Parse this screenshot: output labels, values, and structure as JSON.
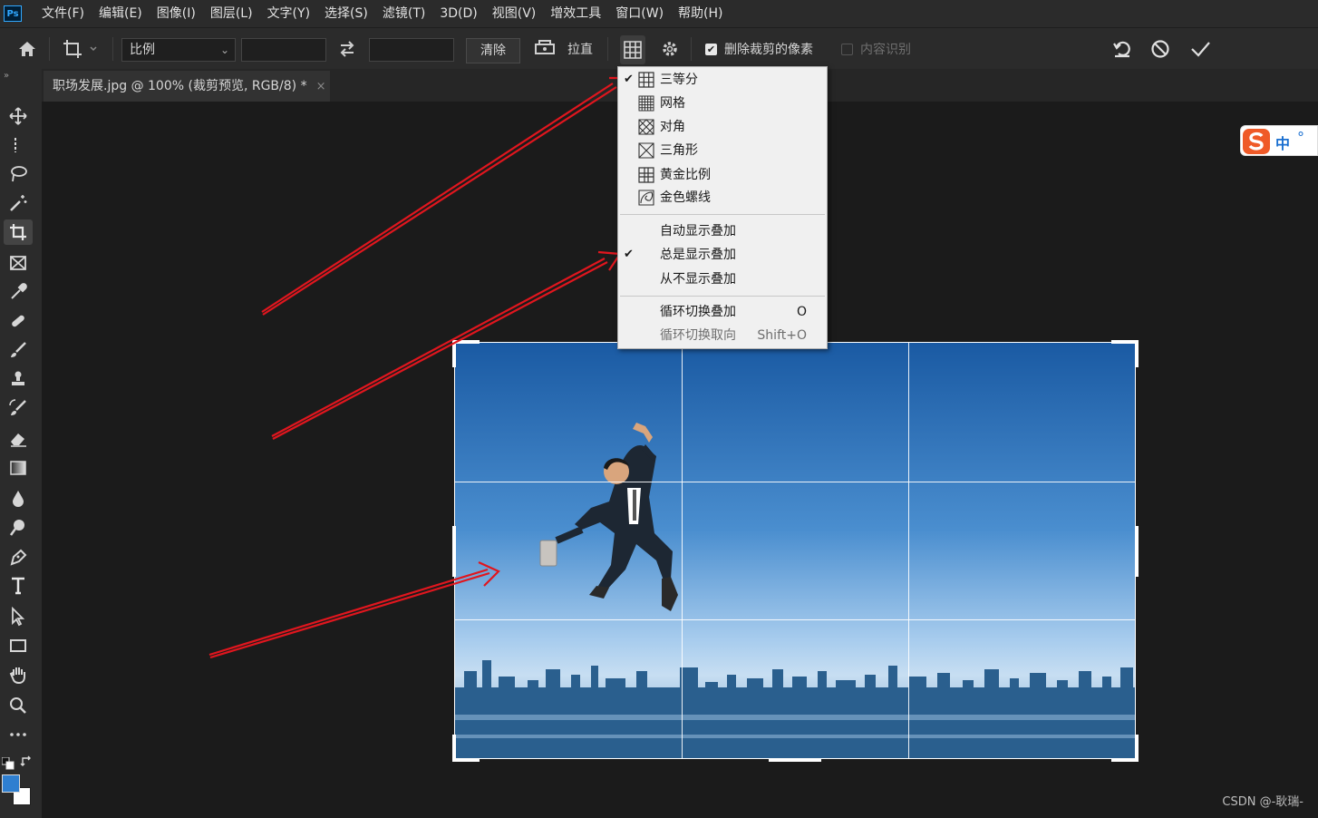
{
  "app": {
    "logo": "Ps"
  },
  "menu": [
    "文件(F)",
    "编辑(E)",
    "图像(I)",
    "图层(L)",
    "文字(Y)",
    "选择(S)",
    "滤镜(T)",
    "3D(D)",
    "视图(V)",
    "增效工具",
    "窗口(W)",
    "帮助(H)"
  ],
  "options": {
    "ratio_select": "比例",
    "clear_label": "清除",
    "straighten_label": "拉直",
    "delete_cropped_label": "删除裁剪的像素",
    "content_aware_label": "内容识别"
  },
  "document": {
    "tab_title": "职场发展.jpg @ 100% (裁剪预览, RGB/8) *",
    "close_glyph": "×"
  },
  "overlay_menu": {
    "items": [
      {
        "label": "三等分",
        "checked": true,
        "icon": "thirds-grid-icon"
      },
      {
        "label": "网格",
        "checked": false,
        "icon": "grid-icon"
      },
      {
        "label": "对角",
        "checked": false,
        "icon": "diagonal-icon"
      },
      {
        "label": "三角形",
        "checked": false,
        "icon": "triangle-icon"
      },
      {
        "label": "黄金比例",
        "checked": false,
        "icon": "golden-ratio-icon"
      },
      {
        "label": "金色螺线",
        "checked": false,
        "icon": "golden-spiral-icon"
      }
    ],
    "display_modes": [
      {
        "label": "自动显示叠加",
        "checked": false
      },
      {
        "label": "总是显示叠加",
        "checked": true
      },
      {
        "label": "从不显示叠加",
        "checked": false
      }
    ],
    "cycle": [
      {
        "label": "循环切换叠加",
        "shortcut": "O",
        "disabled": false
      },
      {
        "label": "循环切换取向",
        "shortcut": "Shift+O",
        "disabled": true
      }
    ]
  },
  "ime": {
    "label": "中"
  },
  "watermark": "CSDN @-耿瑞-",
  "colors": {
    "foreground": "#2f7fd0",
    "background": "#ffffff",
    "arrow": "#e0161e"
  }
}
